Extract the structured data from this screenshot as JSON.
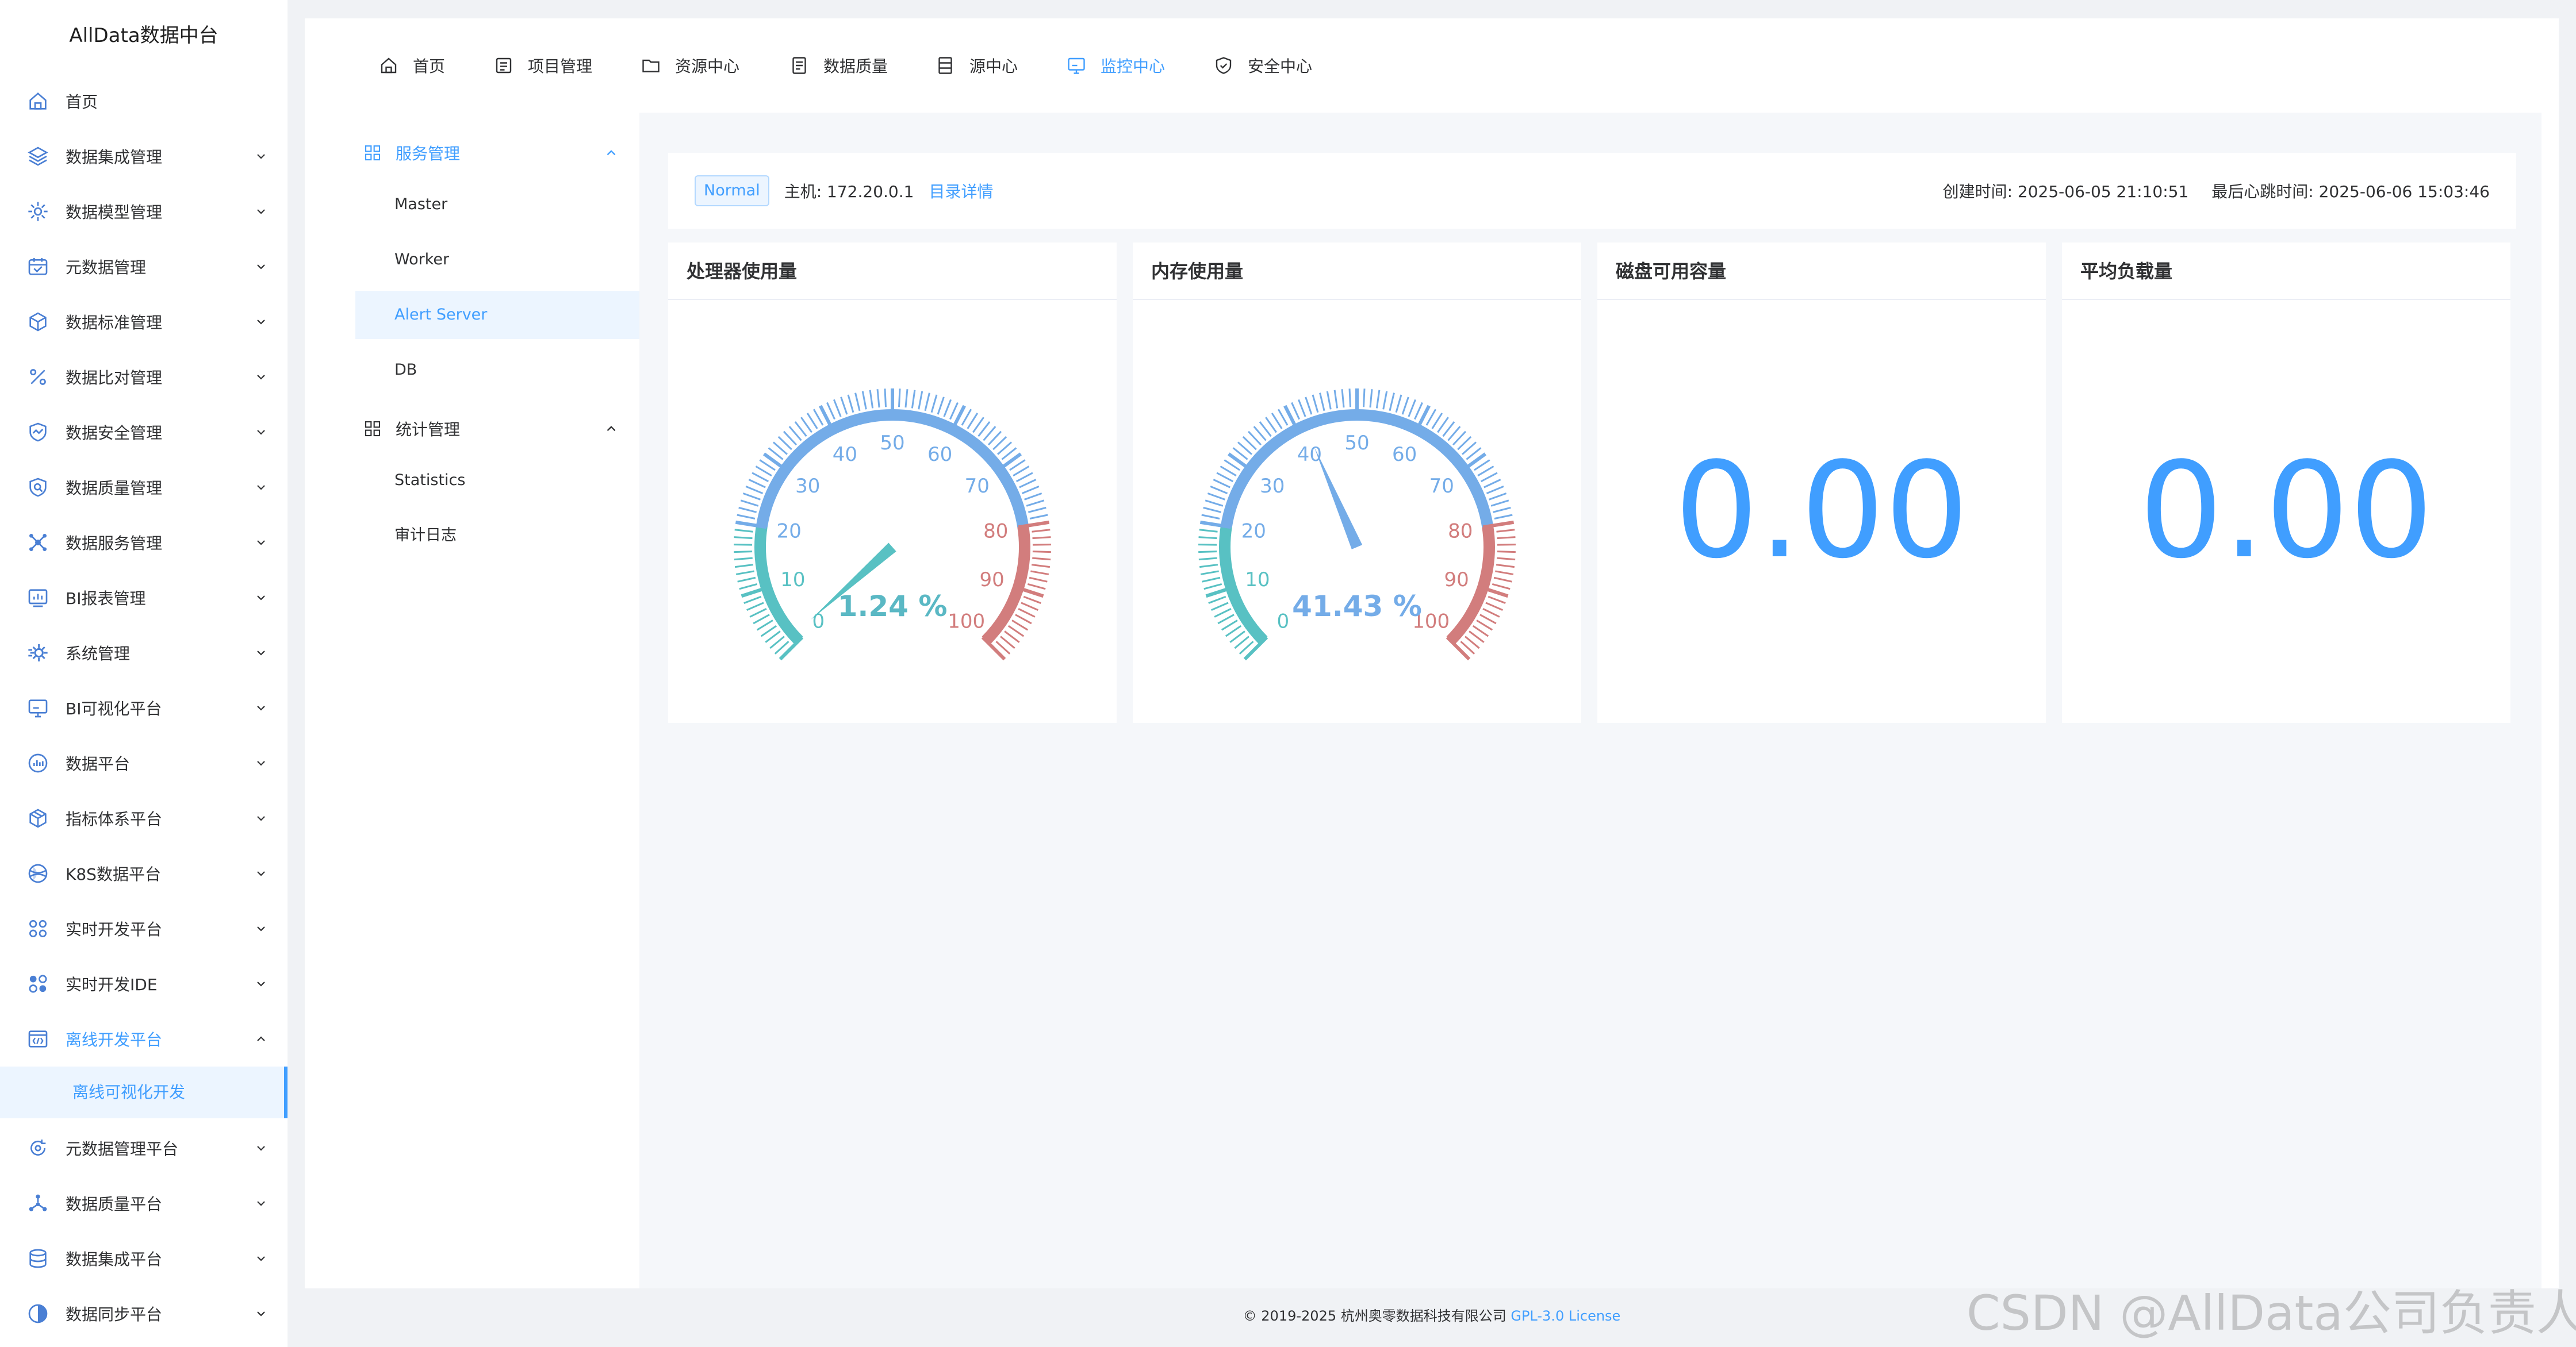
{
  "brand": "AllData数据中台",
  "sidebar": {
    "items": [
      {
        "label": "首页",
        "icon": "home-icon",
        "has_arrow": false
      },
      {
        "label": "数据集成管理",
        "icon": "layers-icon",
        "has_arrow": true
      },
      {
        "label": "数据模型管理",
        "icon": "gear-icon",
        "has_arrow": true
      },
      {
        "label": "元数据管理",
        "icon": "calendar-icon",
        "has_arrow": true
      },
      {
        "label": "数据标准管理",
        "icon": "cube-icon",
        "has_arrow": true
      },
      {
        "label": "数据比对管理",
        "icon": "percent-icon",
        "has_arrow": true
      },
      {
        "label": "数据安全管理",
        "icon": "shield-icon",
        "has_arrow": true
      },
      {
        "label": "数据质量管理",
        "icon": "search-icon",
        "has_arrow": true
      },
      {
        "label": "数据服务管理",
        "icon": "service-icon",
        "has_arrow": true
      },
      {
        "label": "BI报表管理",
        "icon": "report-icon",
        "has_arrow": true
      },
      {
        "label": "系统管理",
        "icon": "system-gear-icon",
        "has_arrow": true
      },
      {
        "label": "BI可视化平台",
        "icon": "monitor-icon",
        "has_arrow": true
      },
      {
        "label": "数据平台",
        "icon": "chart-icon",
        "has_arrow": true
      },
      {
        "label": "指标体系平台",
        "icon": "box-icon",
        "has_arrow": true
      },
      {
        "label": "K8S数据平台",
        "icon": "globe-icon",
        "has_arrow": true
      },
      {
        "label": "实时开发平台",
        "icon": "nodes-icon",
        "has_arrow": true
      },
      {
        "label": "实时开发IDE",
        "icon": "ide-icon",
        "has_arrow": true
      },
      {
        "label": "离线开发平台",
        "icon": "code-window-icon",
        "has_arrow": true,
        "expanded": true
      },
      {
        "label": "元数据管理平台",
        "icon": "refresh-icon",
        "has_arrow": true
      },
      {
        "label": "数据质量平台",
        "icon": "network-icon",
        "has_arrow": true
      },
      {
        "label": "数据集成平台",
        "icon": "database-icon",
        "has_arrow": true
      },
      {
        "label": "数据同步平台",
        "icon": "sync-icon",
        "has_arrow": true
      }
    ],
    "active_sub": "离线可视化开发"
  },
  "topnav": {
    "items": [
      {
        "label": "首页",
        "icon": "home-icon"
      },
      {
        "label": "项目管理",
        "icon": "project-icon"
      },
      {
        "label": "资源中心",
        "icon": "folder-icon"
      },
      {
        "label": "数据质量",
        "icon": "quality-icon"
      },
      {
        "label": "源中心",
        "icon": "datasource-icon"
      },
      {
        "label": "监控中心",
        "icon": "monitor-icon"
      },
      {
        "label": "安全中心",
        "icon": "shield-check-icon"
      }
    ],
    "active": "监控中心"
  },
  "subnav": {
    "groups": [
      {
        "label": "服务管理",
        "items": [
          "Master",
          "Worker",
          "Alert Server",
          "DB"
        ]
      },
      {
        "label": "统计管理",
        "items": [
          "Statistics",
          "审计日志"
        ]
      }
    ],
    "active_item": "Alert Server"
  },
  "info": {
    "status": "Normal",
    "host": "主机: 172.20.0.1",
    "dir_link": "目录详情",
    "created": "创建时间: 2025-06-05 21:10:51",
    "heartbeat": "最后心跳时间: 2025-06-06 15:03:46"
  },
  "cards": [
    {
      "title": "处理器使用量",
      "kind": "gauge",
      "value": 1.24,
      "display": "1.24 %"
    },
    {
      "title": "内存使用量",
      "kind": "gauge",
      "value": 41.43,
      "display": "41.43 %"
    },
    {
      "title": "磁盘可用容量",
      "kind": "number",
      "display": "0.00"
    },
    {
      "title": "平均负载量",
      "kind": "number",
      "display": "0.00"
    }
  ],
  "gauge": {
    "min": 0,
    "max": 100,
    "ticks": [
      "0",
      "10",
      "20",
      "30",
      "40",
      "50",
      "60",
      "70",
      "80",
      "90",
      "100"
    ],
    "colors": {
      "low": "#58c1c3",
      "mid": "#74ace8",
      "high": "#d27d7d",
      "value_text": "#5ab8c4"
    }
  },
  "footer": {
    "copyright": "© 2019-2025 杭州奥零数据科技有限公司 ",
    "license": "GPL-3.0 License"
  },
  "watermark": "CSDN @AllData公司负责人",
  "colors": {
    "accent": "#409eff",
    "active_bg": "#ecf5ff"
  }
}
